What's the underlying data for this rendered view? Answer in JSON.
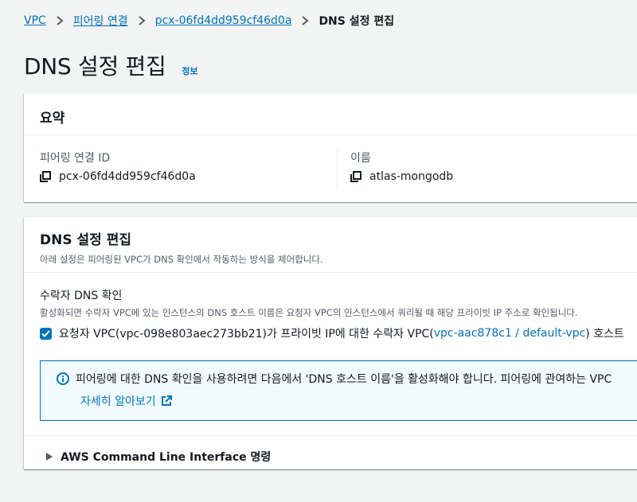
{
  "breadcrumb": {
    "items": [
      "VPC",
      "피어링 연결",
      "pcx-06fd4dd959cf46d0a"
    ],
    "current": "DNS 설정 편집"
  },
  "page": {
    "title": "DNS 설정 편집",
    "info_link": "정보"
  },
  "summary": {
    "title": "요약",
    "peering_id_label": "피어링 연결 ID",
    "peering_id_value": "pcx-06fd4dd959cf46d0a",
    "name_label": "이름",
    "name_value": "atlas-mongodb"
  },
  "settings": {
    "title": "DNS 설정 편집",
    "description": "아래 설정은 피어링된 VPC가 DNS 확인에서 작동하는 방식을 제어합니다.",
    "accepter": {
      "title": "수락자 DNS 확인",
      "description": "활성화되면 수락자 VPC에 있는 인스턴스의 DNS 호스트 이름은 요청자 VPC의 인스턴스에서 쿼리될 때 해당 프라이빗 IP 주소로 확인됩니다.",
      "checkbox_prefix": "요청자 VPC(vpc-098e803aec273bb21)가 프라이빗 IP에 대한 수락자 VPC(",
      "checkbox_link": "vpc-aac878c1 / default-vpc",
      "checkbox_suffix": ") 호스트",
      "checked": true
    },
    "alert": {
      "text": "피어링에 대한 DNS 확인을 사용하려면 다음에서 'DNS 호스트 이름'을 활성화해야 합니다. 피어링에 관여하는 VPC",
      "learn_more": "자세히 알아보기"
    },
    "cli_expander": "AWS Command Line Interface 명령"
  },
  "colors": {
    "link": "#0073bb",
    "background": "#f2f3f3",
    "alert_bg": "#f1faff"
  }
}
